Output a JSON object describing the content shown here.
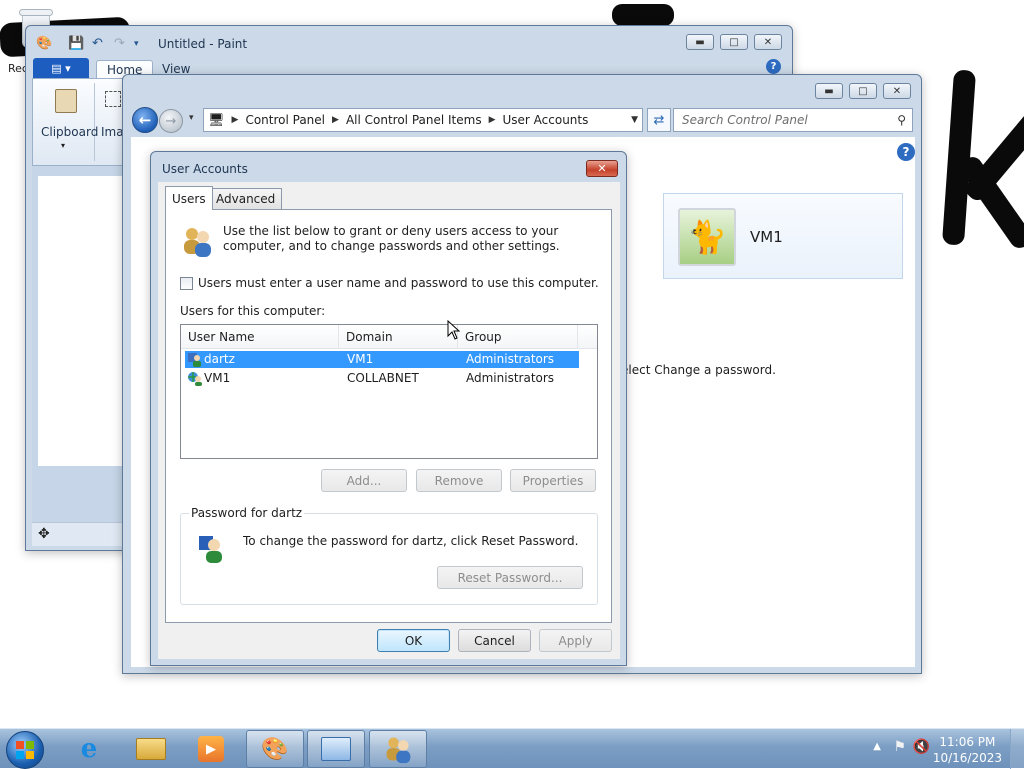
{
  "desktop": {
    "recycle_bin_label": "Rec"
  },
  "paint": {
    "title": "Untitled - Paint",
    "tabs": {
      "file": "▤ ▾",
      "home": "Home",
      "view": "View"
    },
    "ribbon": {
      "clipboard": "Clipboard",
      "image": "Imag"
    }
  },
  "control_panel": {
    "breadcrumb": [
      "Control Panel",
      "All Control Panel Items",
      "User Accounts"
    ],
    "search_placeholder": "Search Control Panel",
    "user_card_name": "VM1",
    "hint_text": "elect Change a password."
  },
  "user_accounts_dialog": {
    "title": "User Accounts",
    "tabs": [
      "Users",
      "Advanced"
    ],
    "intro": "Use the list below to grant or deny users access to your computer, and to change passwords and other settings.",
    "checkbox_label": "Users must enter a user name and password to use this computer.",
    "checkbox_checked": false,
    "users_label": "Users for this computer:",
    "columns": [
      "User Name",
      "Domain",
      "Group"
    ],
    "rows": [
      {
        "user": "dartz",
        "domain": "VM1",
        "group": "Administrators",
        "selected": true
      },
      {
        "user": "VM1",
        "domain": "COLLABNET",
        "group": "Administrators",
        "selected": false
      }
    ],
    "buttons": {
      "add": "Add...",
      "remove": "Remove",
      "properties": "Properties"
    },
    "password_group_title": "Password for dartz",
    "password_text": "To change the password for dartz, click Reset Password.",
    "reset_button": "Reset Password...",
    "footer": {
      "ok": "OK",
      "cancel": "Cancel",
      "apply": "Apply"
    }
  },
  "taskbar": {
    "time": "11:06 PM",
    "date": "10/16/2023",
    "accent": "#1d5dbf"
  }
}
